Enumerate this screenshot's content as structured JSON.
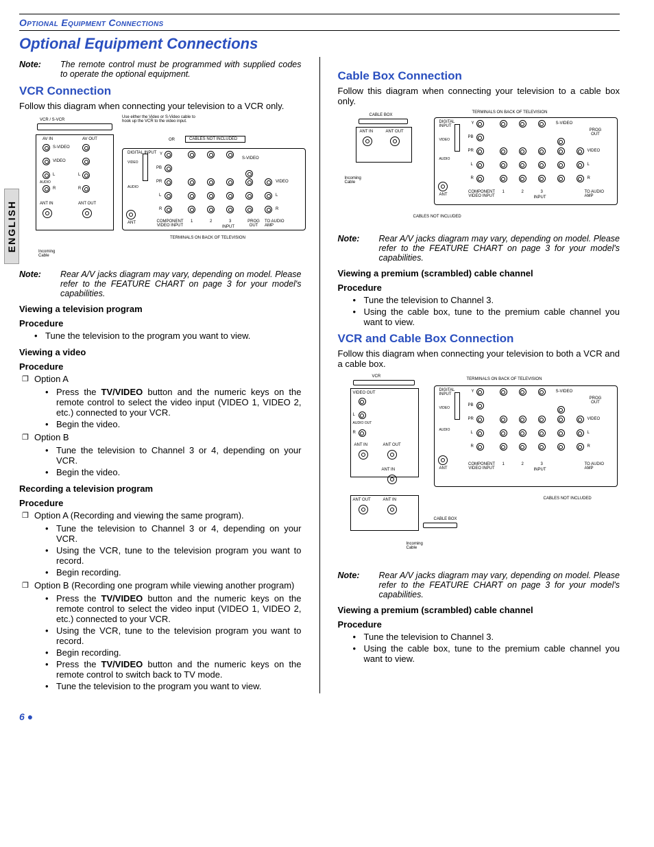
{
  "header": {
    "smallcaps": "Optional Equipment Connections"
  },
  "title": "Optional Equipment Connections",
  "sidetab": "ENGLISH",
  "intro_note": {
    "label": "Note:",
    "text": "The remote control must be programmed with supplied codes to operate the optional equipment."
  },
  "left": {
    "s1": {
      "heading": "VCR Connection",
      "intro": "Follow this diagram when connecting your television to a VCR only.",
      "note": {
        "label": "Note:",
        "text": "Rear A/V jacks diagram may vary, depending on model. Please refer to the FEATURE CHART on page 3 for your model's capabilities."
      },
      "h_view_prog": "Viewing a television program",
      "proc": "Procedure",
      "b_view_prog_1": "Tune the television to the program you want to view.",
      "h_view_video": "Viewing a video",
      "optA": "Option A",
      "optA_1a": "Press the ",
      "tvvideo": "TV/VIDEO",
      "optA_1b": " button and the numeric keys on the remote control to select the video input (VIDEO 1, VIDEO 2, etc.) connected to your VCR.",
      "optA_2": "Begin the video.",
      "optB": "Option B",
      "optB_1": "Tune the television to Channel 3 or 4, depending on your VCR.",
      "optB_2": "Begin the video.",
      "h_rec": "Recording a television program",
      "recA": "Option A (Recording and viewing the same program).",
      "recA_1": "Tune the television to Channel 3 or 4, depending on your VCR.",
      "recA_2": "Using the VCR, tune to the television program you want to record.",
      "recA_3": "Begin recording.",
      "recB": "Option B (Recording one program while viewing another program)",
      "recB_1a": "Press the ",
      "recB_1b": " button and the numeric keys on the remote control to select the video input (VIDEO 1, VIDEO 2, etc.) connected to your VCR.",
      "recB_2": "Using the VCR, tune to the television program you want to record.",
      "recB_3": "Begin recording.",
      "recB_4a": "Press the ",
      "recB_4b": " button and the numeric keys on the remote control to switch back to TV mode.",
      "recB_5": "Tune the television to the program you want to view."
    },
    "diagram1": {
      "vcr": "VCR / S-VCR",
      "hint": "Use either the Video or S-Video cable to hook up the VCR to the video input.",
      "or": "OR",
      "cni": "CABLES NOT INCLUDED",
      "avin": "AV IN",
      "avout": "AV OUT",
      "svideo": "S-VIDEO",
      "video": "VIDEO",
      "L": "L",
      "R": "R",
      "audio": "AUDIO",
      "antin": "ANT IN",
      "antout": "ANT OUT",
      "ant": "ANT",
      "digital": "DIGITAL INPUT",
      "y": "Y",
      "pb": "PB",
      "pr": "PR",
      "comp": "COMPONENT VIDEO INPUT",
      "input": "INPUT",
      "n1": "1",
      "n2": "2",
      "n3": "3",
      "prog": "PROG OUT",
      "toamp": "TO AUDIO AMP",
      "terms": "TERMINALS ON BACK OF TELEVISION",
      "incoming": "Incoming Cable"
    }
  },
  "right": {
    "s2": {
      "heading": "Cable Box Connection",
      "intro": "Follow this diagram when connecting your television to a cable box only.",
      "note": {
        "label": "Note:",
        "text": "Rear A/V jacks diagram may vary, depending on model. Please refer to the FEATURE CHART on page 3 for your model's capabilities."
      },
      "h_premium": "Viewing a premium (scrambled) cable channel",
      "proc": "Procedure",
      "p1": "Tune the television to Channel 3.",
      "p2": "Using the cable box, tune to the premium cable channel you want to view."
    },
    "s3": {
      "heading": "VCR and Cable Box Connection",
      "intro": "Follow this diagram when connecting your television to both a VCR and a cable box.",
      "note": {
        "label": "Note:",
        "text": "Rear A/V jacks diagram may vary, depending on model. Please refer to the FEATURE CHART on page 3 for your model's capabilities."
      },
      "h_premium": "Viewing a premium (scrambled) cable channel",
      "proc": "Procedure",
      "p1": "Tune the television to Channel 3.",
      "p2": "Using the cable box, tune to the premium cable channel you want to view."
    },
    "diagram2": {
      "cablebox": "CABLE BOX",
      "antin": "ANT IN",
      "antout": "ANT OUT",
      "incoming": "Incoming Cable",
      "cni": "CABLES NOT INCLUDED",
      "terms": "TERMINALS ON BACK OF TELEVISION",
      "digital": "DIGITAL INPUT",
      "video": "VIDEO",
      "audio": "AUDIO",
      "L": "L",
      "R": "R",
      "ant": "ANT",
      "y": "Y",
      "pb": "PB",
      "pr": "PR",
      "svideo": "S-VIDEO",
      "prog": "PROG OUT",
      "comp": "COMPONENT VIDEO INPUT",
      "n1": "1",
      "n2": "2",
      "n3": "3",
      "input": "INPUT",
      "toamp": "TO AUDIO AMP"
    },
    "diagram3": {
      "vcr": "VCR",
      "videoout": "VIDEO OUT",
      "audioout": "AUDIO OUT",
      "L": "L",
      "R": "R",
      "antin": "ANT IN",
      "antout": "ANT OUT",
      "antin2": "ANT IN",
      "cablebox": "CABLE BOX",
      "incoming": "Incoming Cable",
      "cni": "CABLES NOT INCLUDED",
      "terms": "TERMINALS ON BACK OF TELEVISION",
      "digital": "DIGITAL INPUT",
      "video": "VIDEO",
      "audio": "AUDIO",
      "ant": "ANT",
      "y": "Y",
      "pb": "PB",
      "pr": "PR",
      "svideo": "S-VIDEO",
      "prog": "PROG OUT",
      "vlabel": "VIDEO",
      "comp": "COMPONENT VIDEO INPUT",
      "n1": "1",
      "n2": "2",
      "n3": "3",
      "input": "INPUT",
      "toamp": "TO AUDIO AMP"
    }
  },
  "page": "6",
  "dot": "●"
}
